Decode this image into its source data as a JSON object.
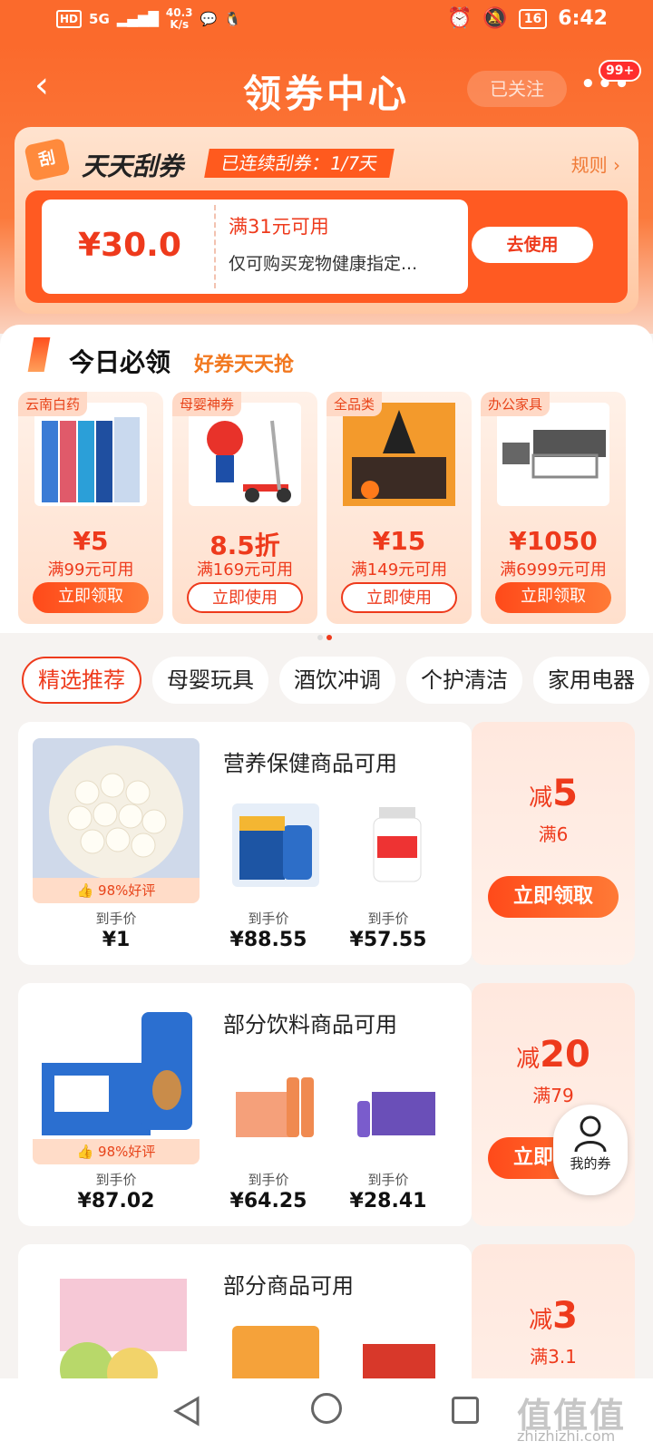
{
  "status_bar": {
    "network": "HD",
    "signal": "5G",
    "speed": "40.3",
    "speed_unit": "K/s",
    "battery": "16",
    "time": "6:42"
  },
  "header": {
    "title": "领券中心",
    "follow_label": "已关注",
    "more_badge": "99+"
  },
  "scratch": {
    "icon_char": "刮",
    "title": "天天刮券",
    "streak": "已连续刮券：1/7天",
    "rules": "规则 ›",
    "coupon": {
      "amount": "¥30.0",
      "condition": "满31元可用",
      "description": "仅可购买宠物健康指定...",
      "button": "去使用"
    }
  },
  "today": {
    "title": "今日必领",
    "subtitle": "好券天天抢",
    "cards": [
      {
        "tag": "云南白药",
        "value": "¥5",
        "condition": "满99元可用",
        "button": "立即领取",
        "style": "fill"
      },
      {
        "tag": "母婴神券",
        "value": "8.5折",
        "condition": "满169元可用",
        "button": "立即使用",
        "style": "line"
      },
      {
        "tag": "全品类",
        "value": "¥15",
        "condition": "满149元可用",
        "button": "立即使用",
        "style": "line"
      },
      {
        "tag": "办公家具",
        "value": "¥1050",
        "condition": "满6999元可用",
        "button": "立即领取",
        "style": "fill"
      }
    ]
  },
  "tabs": [
    "精选推荐",
    "母婴玩具",
    "酒饮冲调",
    "个护清洁",
    "家用电器"
  ],
  "rows": [
    {
      "title": "营养保健商品可用",
      "rating": "98%好评",
      "price_label": "到手价",
      "prices": [
        "¥1",
        "¥88.55",
        "¥57.55"
      ],
      "off_prefix": "减",
      "off_value": "5",
      "min": "满6",
      "button": "立即领取"
    },
    {
      "title": "部分饮料商品可用",
      "rating": "98%好评",
      "price_label": "到手价",
      "prices": [
        "¥87.02",
        "¥64.25",
        "¥28.41"
      ],
      "off_prefix": "减",
      "off_value": "20",
      "min": "满79",
      "button": "立即领取"
    },
    {
      "title": "部分商品可用",
      "off_prefix": "减",
      "off_value": "3",
      "min": "满3.1"
    }
  ],
  "floating": {
    "label": "我的券"
  },
  "watermark": {
    "text": "值值值",
    "url": "zhizhizhi.com"
  },
  "colors": {
    "brand": "#fb6a2c",
    "accent": "#ee3a1c",
    "tag_bg": "#ffd9c6"
  }
}
